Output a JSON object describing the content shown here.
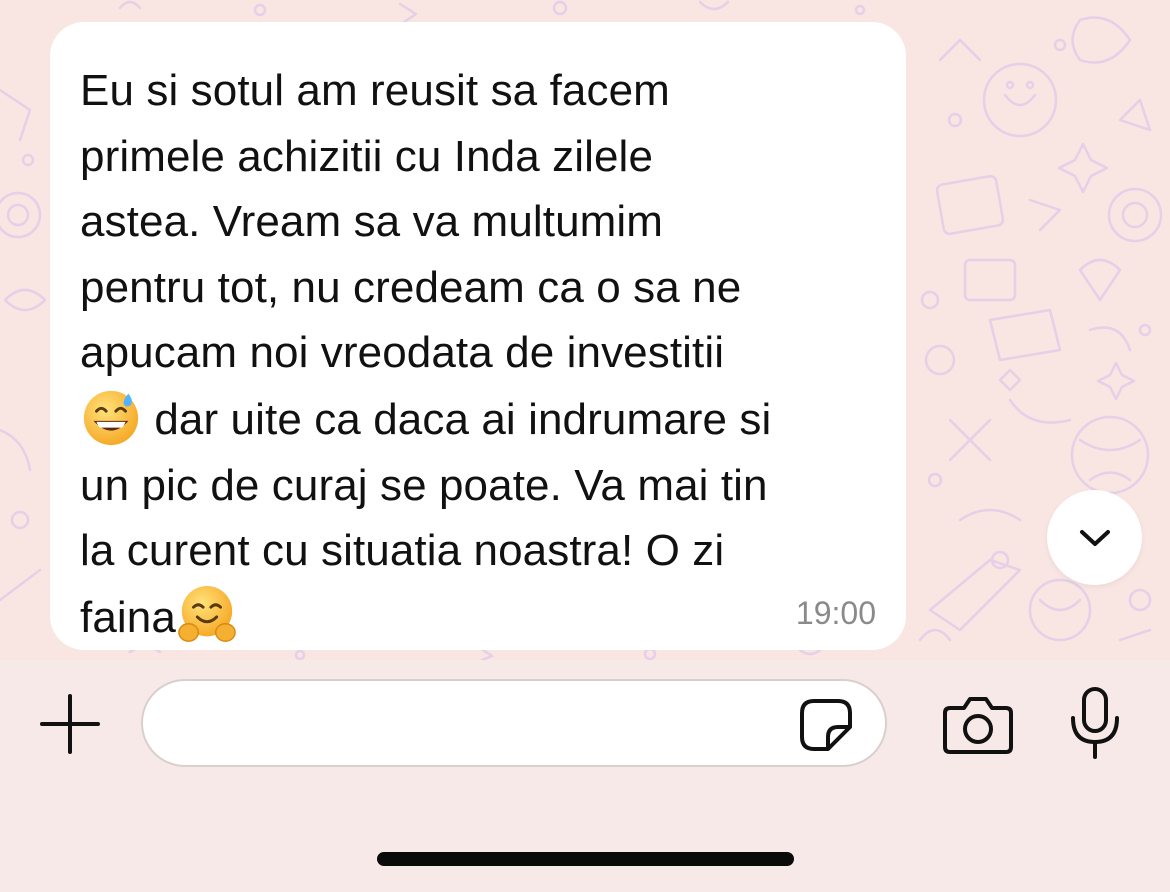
{
  "chat": {
    "message": {
      "lines": [
        "Eu si sotul am reusit sa facem",
        "primele achizitii cu Inda zilele",
        "astea. Vream sa va multumim",
        "pentru tot, nu credeam ca o sa ne",
        "apucam noi vreodata de investitii",
        " dar uite ca daca ai indrumare si",
        "un pic de curaj se poate. Va mai tin",
        "la curent cu situatia noastra! O zi",
        "faina"
      ],
      "emojis": [
        "grinning-face-with-sweat-emoji",
        "hugging-face-emoji"
      ],
      "time": "19:00"
    },
    "scroll_down_icon": "chevron-down-icon"
  },
  "composer": {
    "value": "",
    "placeholder": "",
    "icons": [
      "plus-icon",
      "sticker-icon",
      "camera-icon",
      "microphone-icon"
    ]
  },
  "colors": {
    "chat_background": "#f9e5e1",
    "doodle": "#e6cfe8",
    "bubble": "#ffffff",
    "composer_background": "#f7e9e7",
    "timestamp": "#8a8a8a",
    "icon": "#111111"
  }
}
